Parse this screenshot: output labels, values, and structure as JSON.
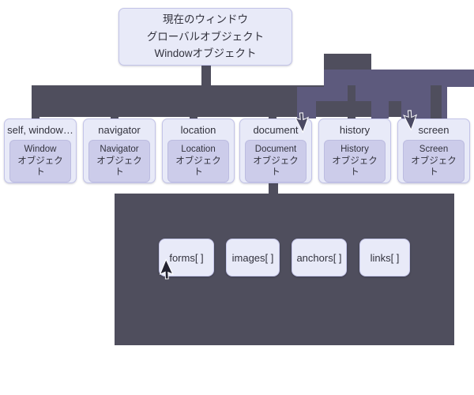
{
  "diagram": {
    "title_box": {
      "lines": [
        "現在のウィンドウ",
        "グローバルオブジェクト",
        "Windowオブジェクト"
      ]
    },
    "property_nodes": [
      {
        "name": "self, window…",
        "object_line1": "Window",
        "object_line2": "オブジェクト"
      },
      {
        "name": "navigator",
        "object_line1": "Navigator",
        "object_line2": "オブジェクト"
      },
      {
        "name": "location",
        "object_line1": "Location",
        "object_line2": "オブジェクト"
      },
      {
        "name": "document",
        "object_line1": "Document",
        "object_line2": "オブジェクト"
      },
      {
        "name": "history",
        "object_line1": "History",
        "object_line2": "オブジェクト"
      },
      {
        "name": "screen",
        "object_line1": "Screen",
        "object_line2": "オブジェクト"
      }
    ],
    "collection_nodes": [
      {
        "name": "forms[ ]"
      },
      {
        "name": "images[ ]"
      },
      {
        "name": "anchors[ ]"
      },
      {
        "name": "links[ ]"
      }
    ],
    "cursors": [
      {
        "name": "cursor-forms"
      },
      {
        "name": "cursor-document"
      },
      {
        "name": "cursor-screen"
      }
    ],
    "colors": {
      "node_fill": "#e8eaf8",
      "node_border": "#c3c4e8",
      "inner_fill": "#ccccea",
      "connector_dark": "#4f4e5d",
      "connector_mid": "#5d5a7d",
      "text": "#32323d",
      "background": "#ffffff"
    }
  }
}
